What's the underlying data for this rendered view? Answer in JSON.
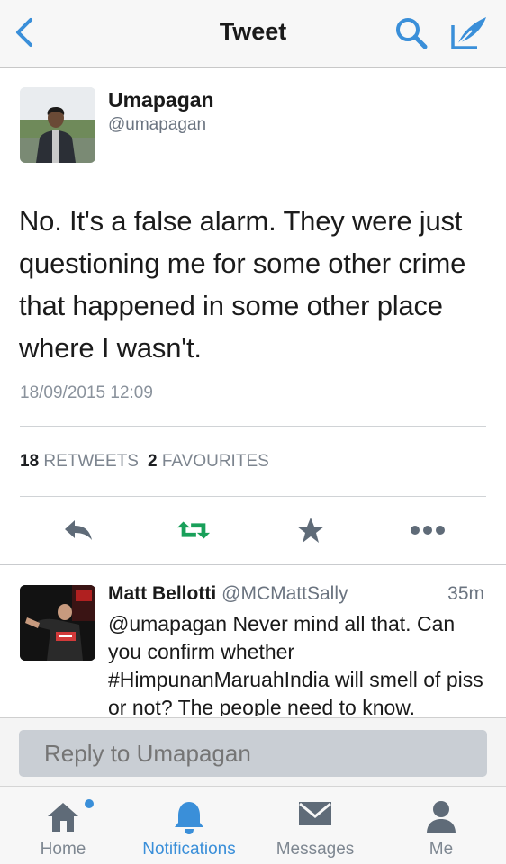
{
  "header": {
    "title": "Tweet"
  },
  "tweet": {
    "author_name": "Umapagan",
    "author_handle": "@umapagan",
    "text": "No. It's a false alarm. They were just questioning me for some other crime that happened in some other place where I wasn't.",
    "timestamp": "18/09/2015 12:09",
    "retweets_count": "18",
    "retweets_label": "RETWEETS",
    "favourites_count": "2",
    "favourites_label": "FAVOURITES"
  },
  "reply_item": {
    "name": "Matt Bellotti",
    "handle": "@MCMattSally",
    "time": "35m",
    "text": "@umapagan Never mind all that. Can you confirm whether #HimpunanMaruahIndia will smell of piss or not? The people need to know."
  },
  "reply_box": {
    "placeholder": "Reply to Umapagan"
  },
  "tabs": [
    {
      "label": "Home",
      "icon": "home-icon",
      "active": false,
      "badge": true
    },
    {
      "label": "Notifications",
      "icon": "bell-icon",
      "active": true,
      "badge": false
    },
    {
      "label": "Messages",
      "icon": "envelope-icon",
      "active": false,
      "badge": false
    },
    {
      "label": "Me",
      "icon": "person-icon",
      "active": false,
      "badge": false
    }
  ],
  "colors": {
    "accent": "#3a8fd9",
    "retweet_green": "#19a05a",
    "icon_gray": "#5f6b78",
    "muted_text": "#7d858f"
  }
}
